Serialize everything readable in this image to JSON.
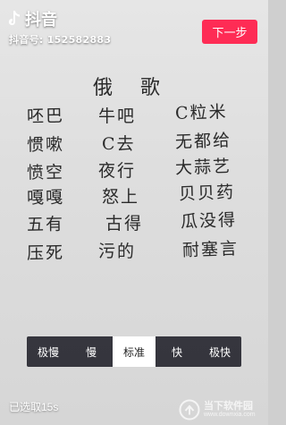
{
  "app": {
    "name": "抖音",
    "account_text": "抖音号: 152582883"
  },
  "toolbar": {
    "next_label": "下一步"
  },
  "poem": {
    "title": "俄 歌",
    "lines": [
      "呸巴",
      "牛吧",
      "C粒米",
      "惯嗽",
      "C去",
      "无都给",
      "愤空",
      "夜行",
      "大蒜艺",
      "嘎嘎",
      "怒上",
      "贝贝药",
      "五有",
      "古得",
      "瓜没得",
      "压死",
      "污的",
      "耐塞言"
    ]
  },
  "speed": {
    "options": [
      "极慢",
      "慢",
      "标准",
      "快",
      "极快"
    ],
    "selected": "标准"
  },
  "status": {
    "selected_duration": "已选取15s"
  },
  "watermark": {
    "name": "当下软件园",
    "url": "www.downxia.com"
  },
  "colors": {
    "accent": "#fe2c55",
    "speed_bar": "#24242c"
  }
}
